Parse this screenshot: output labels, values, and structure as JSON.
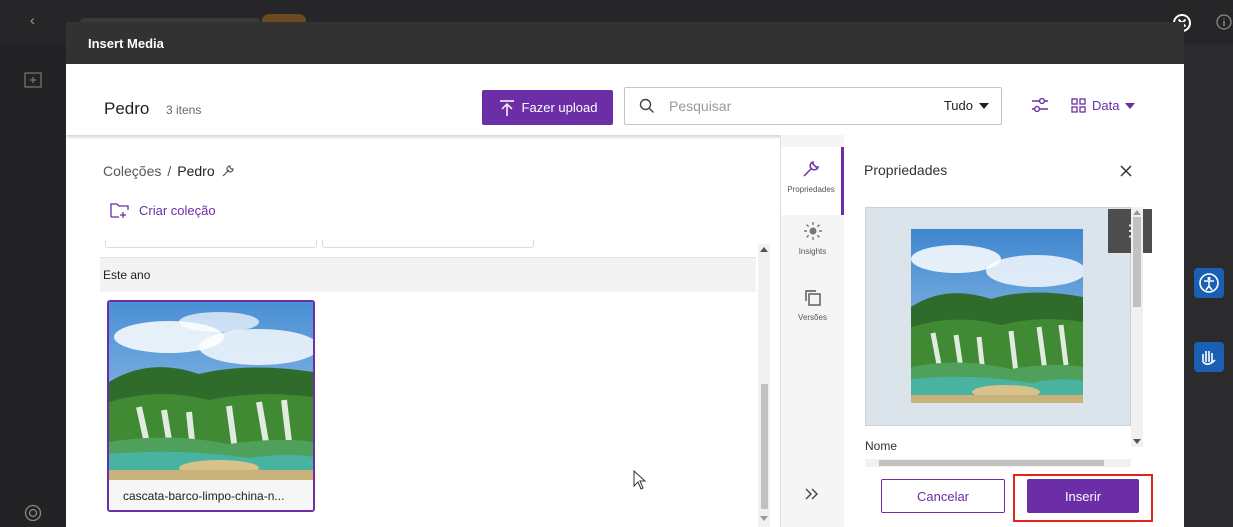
{
  "modal": {
    "title": "Insert Media"
  },
  "toolbar": {
    "folder_name": "Pedro",
    "item_count": "3 itens",
    "upload_label": "Fazer upload",
    "search_placeholder": "Pesquisar",
    "scope": "Tudo",
    "sort_label": "Data"
  },
  "breadcrumb": {
    "root": "Coleções",
    "separator": "/",
    "current": "Pedro"
  },
  "create_collection": "Criar coleção",
  "section": {
    "label": "Este ano"
  },
  "assets": [
    {
      "name": "cascata-barco-limpo-china-n..."
    }
  ],
  "rail": {
    "items": [
      "Propriedades",
      "Insights",
      "Versões"
    ]
  },
  "properties": {
    "title": "Propriedades",
    "field_label": "Nome"
  },
  "actions": {
    "cancel": "Cancelar",
    "insert": "Inserir"
  },
  "colors": {
    "accent": "#6b2ea6",
    "highlight": "#e2231a",
    "header": "#323232"
  }
}
